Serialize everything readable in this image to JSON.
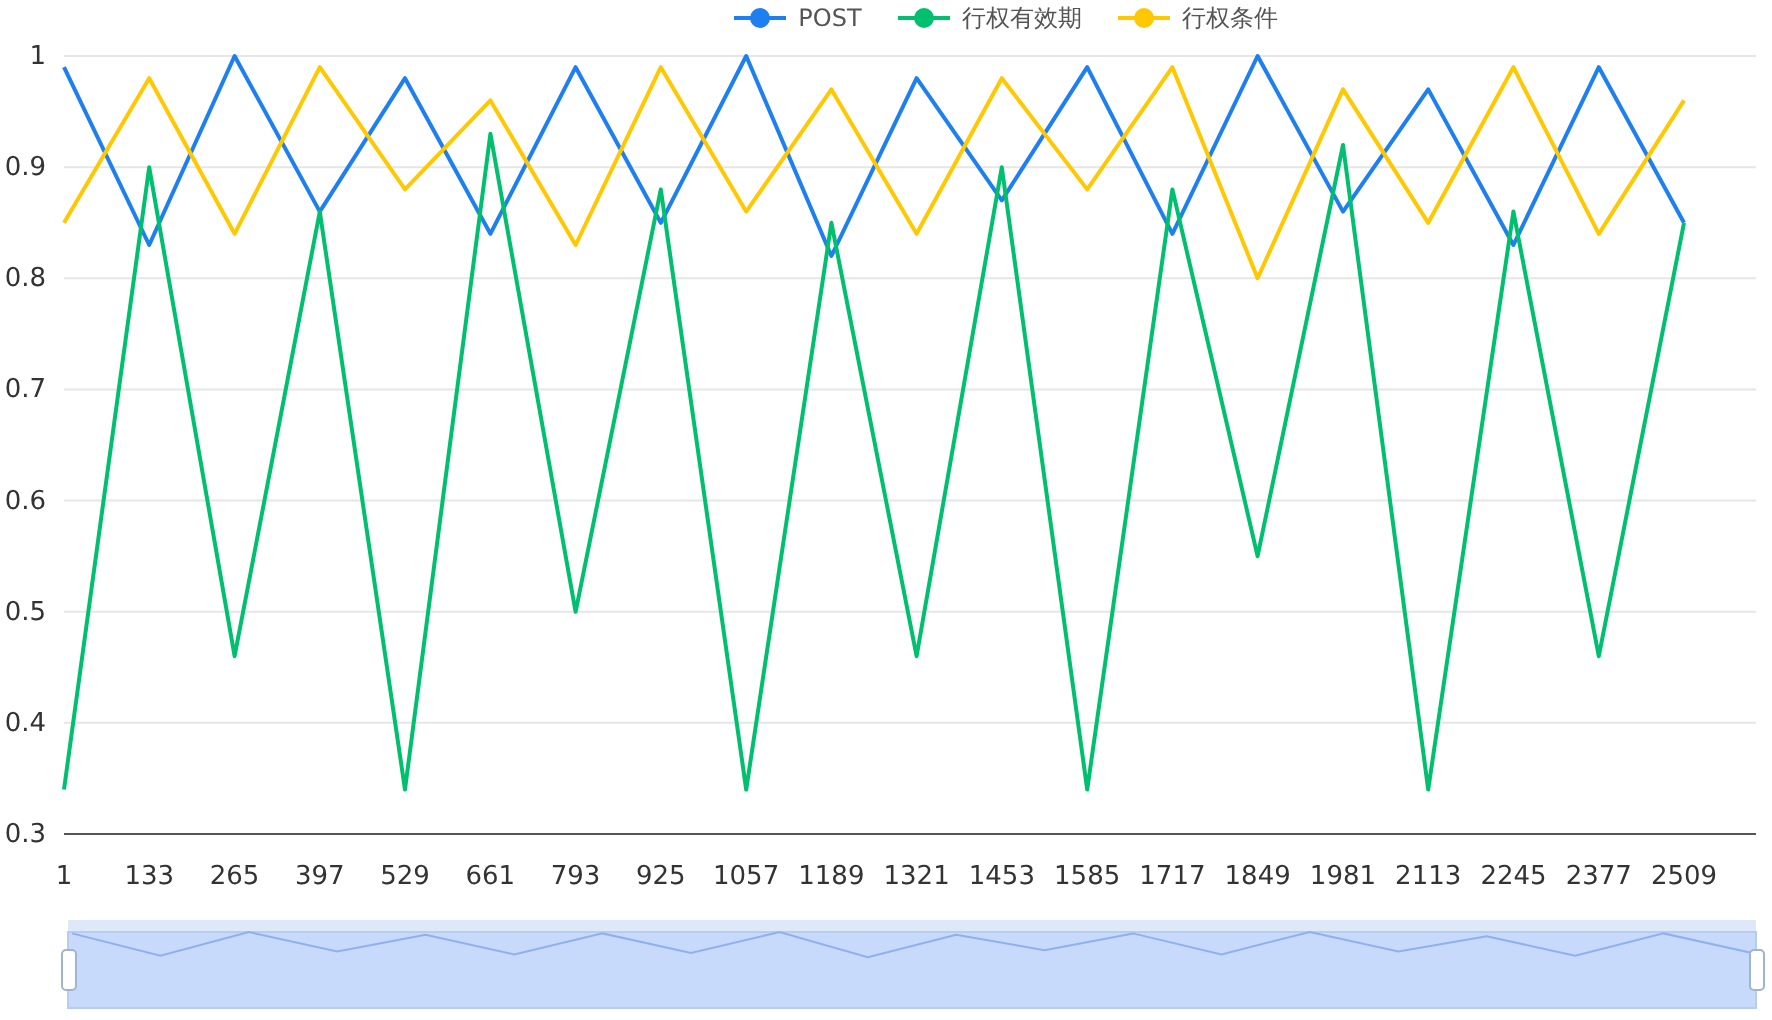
{
  "chart_data": {
    "type": "line",
    "ylim": [
      0.3,
      1
    ],
    "grid": true,
    "categories": [
      "1",
      "133",
      "265",
      "397",
      "529",
      "661",
      "793",
      "925",
      "1057",
      "1189",
      "1321",
      "1453",
      "1585",
      "1717",
      "1849",
      "1981",
      "2113",
      "2245",
      "2377",
      "2509"
    ],
    "yticks": [
      {
        "value": 0.3,
        "label": "0.3"
      },
      {
        "value": 0.4,
        "label": "0.4"
      },
      {
        "value": 0.5,
        "label": "0.5"
      },
      {
        "value": 0.6,
        "label": "0.6"
      },
      {
        "value": 0.7,
        "label": "0.7"
      },
      {
        "value": 0.8,
        "label": "0.8"
      },
      {
        "value": 0.9,
        "label": "0.9"
      },
      {
        "value": 1,
        "label": "1"
      }
    ],
    "series": [
      {
        "name": "POST",
        "color": "#1e7ff0",
        "values": [
          0.99,
          0.83,
          1,
          0.86,
          0.98,
          0.84,
          0.99,
          0.85,
          1,
          0.82,
          0.98,
          0.87,
          0.99,
          0.84,
          1,
          0.86,
          0.97,
          0.83,
          0.99,
          0.85
        ]
      },
      {
        "name": "行权有效期",
        "color": "#00c070",
        "values": [
          0.34,
          0.9,
          0.46,
          0.86,
          0.34,
          0.93,
          0.5,
          0.88,
          0.34,
          0.85,
          0.46,
          0.9,
          0.34,
          0.88,
          0.55,
          0.92,
          0.34,
          0.86,
          0.46,
          0.85
        ]
      },
      {
        "name": "行权条件",
        "color": "#ffc800",
        "values": [
          0.85,
          0.98,
          0.84,
          0.99,
          0.88,
          0.96,
          0.83,
          0.99,
          0.86,
          0.97,
          0.84,
          0.98,
          0.88,
          0.99,
          0.8,
          0.97,
          0.85,
          0.99,
          0.84,
          0.96
        ]
      }
    ]
  },
  "data_zoom": {
    "level": 1
  }
}
